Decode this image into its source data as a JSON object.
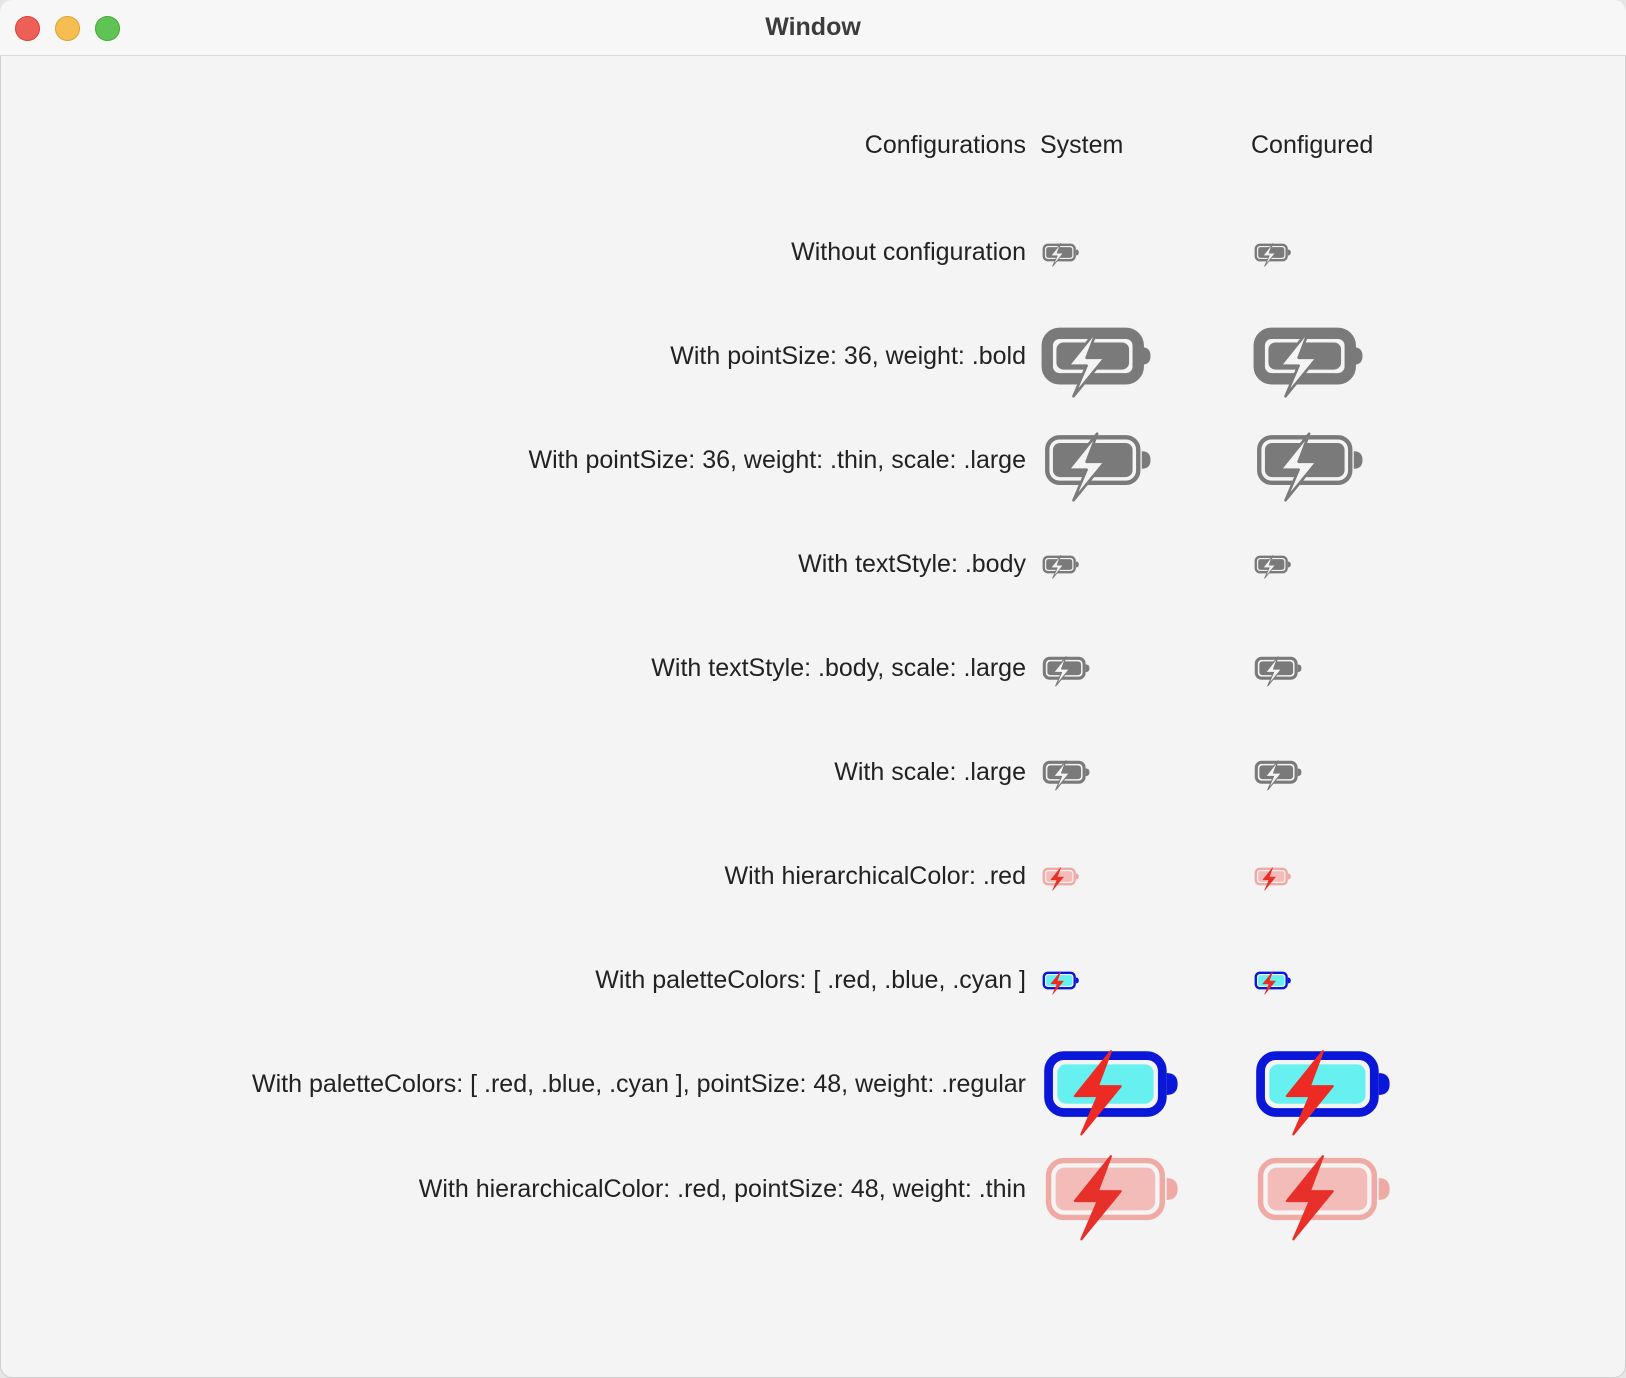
{
  "window": {
    "title": "Window",
    "controls": {
      "close": "close-button",
      "minimize": "minimize-button",
      "zoom": "zoom-button"
    }
  },
  "table": {
    "headers": {
      "configurations": "Configurations",
      "system": "System",
      "configured": "Configured"
    },
    "symbol": "battery-100-bolt-icon",
    "rows": [
      {
        "label": "Without configuration",
        "style": "mono",
        "weight": "regular",
        "size": "small"
      },
      {
        "label": "With pointSize: 36, weight: .bold",
        "style": "mono",
        "weight": "bold",
        "size": "large"
      },
      {
        "label": "With pointSize: 36, weight: .thin, scale: .large",
        "style": "mono",
        "weight": "thin",
        "size": "large"
      },
      {
        "label": "With textStyle: .body",
        "style": "mono",
        "weight": "regular",
        "size": "small"
      },
      {
        "label": "With textStyle: .body, scale: .large",
        "style": "mono",
        "weight": "regular",
        "size": "medium"
      },
      {
        "label": "With scale: .large",
        "style": "mono",
        "weight": "regular",
        "size": "medium"
      },
      {
        "label": "With hierarchicalColor: .red",
        "style": "hierarchical",
        "weight": "regular",
        "size": "small"
      },
      {
        "label": "With paletteColors: [ .red, .blue, .cyan ]",
        "style": "palette",
        "weight": "regular",
        "size": "small"
      },
      {
        "label": "With paletteColors: [ .red, .blue, .cyan ], pointSize: 48, weight: .regular",
        "style": "palette",
        "weight": "regular",
        "size": "xlarge"
      },
      {
        "label": "With hierarchicalColor: .red, pointSize: 48, weight: .thin",
        "style": "hierarchical",
        "weight": "thin",
        "size": "xlarge"
      }
    ]
  },
  "colors": {
    "mono": "#7a7a7a",
    "hierarchical_primary": "#e8302a",
    "hierarchical_secondary": "#efaaa6",
    "hierarchical_fill": "#f4bcb8",
    "palette_red": "#ee2a24",
    "palette_blue": "#0a16d8",
    "palette_cyan": "#66f0f0"
  }
}
